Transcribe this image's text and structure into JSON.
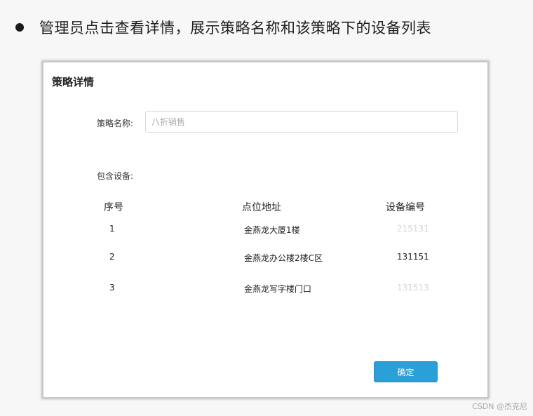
{
  "slide": {
    "title": "管理员点击查看详情，展示策略名称和该策略下的设备列表"
  },
  "dialog": {
    "title": "策略详情",
    "name_label": "策略名称:",
    "name_placeholder": "八折销售",
    "devices_label": "包含设备:",
    "columns": [
      "序号",
      "点位地址",
      "设备编号"
    ],
    "rows": [
      {
        "index": "1",
        "address": "金燕龙大厦1楼",
        "device_no": "215131"
      },
      {
        "index": "2",
        "address": "金燕龙办公楼2楼C区",
        "device_no": "131151"
      },
      {
        "index": "3",
        "address": "金燕龙写字楼门口",
        "device_no": "131513"
      }
    ],
    "confirm_label": "确定"
  },
  "watermark": "CSDN @杰克尼",
  "colors": {
    "primary_button": "#2a9fd8",
    "faded_text": "#d6d6d6"
  }
}
